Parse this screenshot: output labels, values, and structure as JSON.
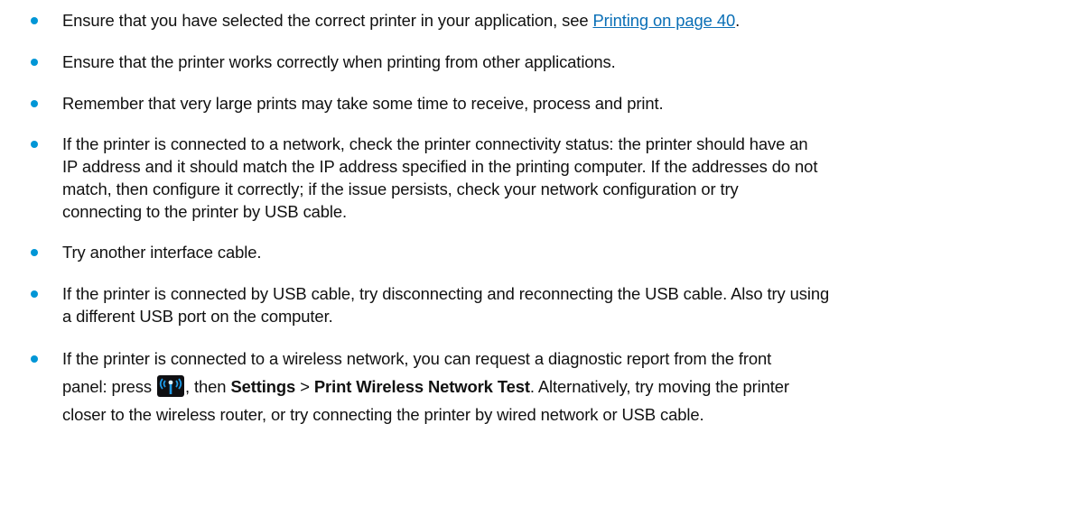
{
  "items": [
    {
      "before": "Ensure that you have selected the correct printer in your application, see ",
      "link": "Printing on page 40",
      "after": "."
    },
    {
      "text": "Ensure that the printer works correctly when printing from other applications."
    },
    {
      "text": "Remember that very large prints may take some time to receive, process and print."
    },
    {
      "lines": [
        "If the printer is connected to a network, check the printer connectivity status: the printer should have an",
        "IP address and it should match the IP address specified in the printing computer. If the addresses do not",
        "match, then configure it correctly; if the issue persists, check your network configuration or try",
        "connecting to the printer by USB cable."
      ]
    },
    {
      "text": "Try another interface cable."
    },
    {
      "lines": [
        "If the printer is connected by USB cable, try disconnecting and reconnecting the USB cable. Also try using",
        "a different USB port on the computer."
      ]
    },
    {
      "line1": "If the printer is connected to a wireless network, you can request a diagnostic report from the front",
      "line2_before": "panel: press ",
      "icon": "wireless-icon",
      "line2_mid": ", then ",
      "settings": "Settings",
      "sep": " > ",
      "test": "Print Wireless Network Test",
      "line2_after": ". Alternatively, try moving the printer",
      "line3": "closer to the wireless router, or try connecting the printer by wired network or USB cable."
    }
  ],
  "colors": {
    "bullet": "#0096d6",
    "link": "#0a6fb6",
    "icon_bg": "#0f0f12",
    "icon_fg": "#1e9be8"
  }
}
